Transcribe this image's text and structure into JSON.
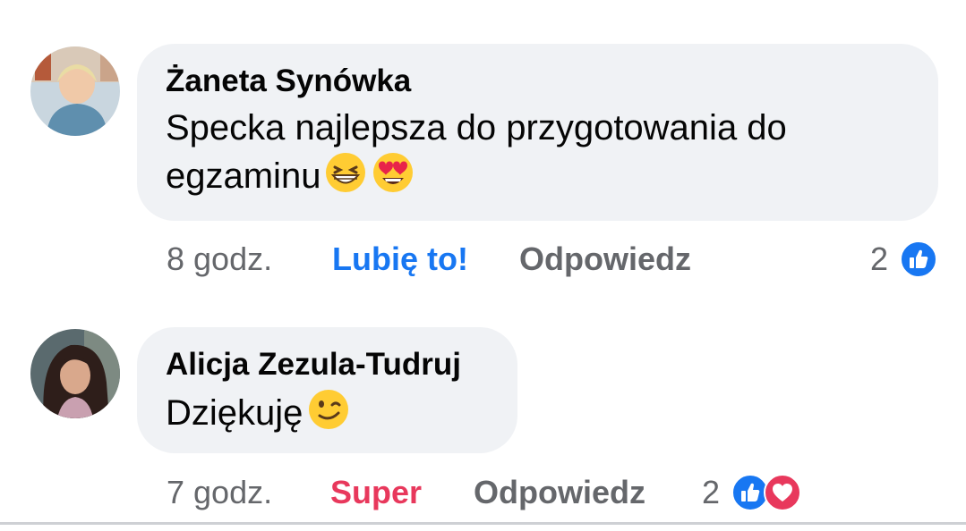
{
  "comments": [
    {
      "author": "Żaneta Synówka",
      "text": "Specka najlepsza do przygotowania do egzaminu",
      "emojis": [
        "grinning-squinting-face-icon",
        "heart-eyes-face-icon"
      ],
      "time": "8 godz.",
      "reaction_action": "Lubię to!",
      "reply_label": "Odpowiedz",
      "reaction_count": "2",
      "reaction_types": [
        "like-icon"
      ]
    },
    {
      "author": "Alicja Zezula-Tudruj",
      "text": "Dziękuję",
      "emojis": [
        "winking-face-icon"
      ],
      "time": "7 godz.",
      "reaction_action": "Super",
      "reply_label": "Odpowiedz",
      "reaction_count": "2",
      "reaction_types": [
        "like-icon",
        "heart-icon"
      ]
    }
  ],
  "colors": {
    "like_blue": "#1877f2",
    "love_red": "#e8385c",
    "bubble_bg": "#f0f2f5",
    "muted_text": "#65676b"
  }
}
